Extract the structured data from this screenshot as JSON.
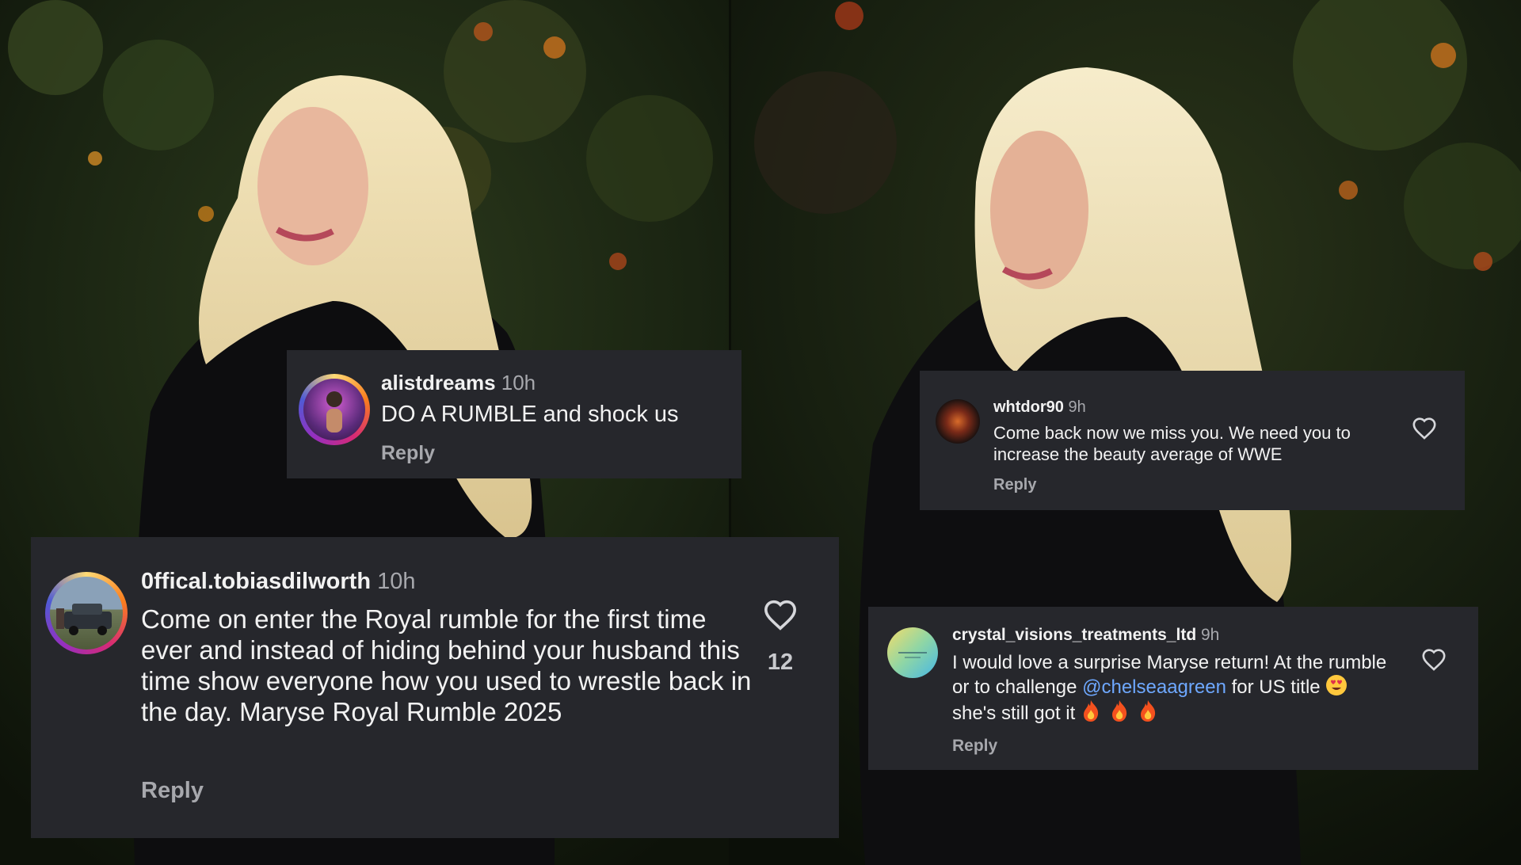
{
  "comments": {
    "c1": {
      "username": "alistdreams",
      "time": "10h",
      "text": "DO A RUMBLE and shock us",
      "reply": "Reply"
    },
    "c2": {
      "username": "0ffical.tobiasdilworth",
      "time": "10h",
      "text": "Come on enter the Royal rumble for the first time ever and instead of hiding behind your husband this time show everyone how you used to wrestle back in the day. Maryse Royal Rumble 2025",
      "reply": "Reply",
      "likes": "12"
    },
    "c3": {
      "username": "whtdor90",
      "time": "9h",
      "text": "Come back now we miss you. We need you to increase the beauty average of WWE",
      "reply": "Reply"
    },
    "c4": {
      "username": "crystal_visions_treatments_ltd",
      "time": "9h",
      "text_before": "I would love a surprise Maryse return! At the rumble or to challenge ",
      "mention": "@chelseaagreen",
      "text_after": " for US title ",
      "text_after_emoji": " she's still got it ",
      "reply": "Reply"
    }
  },
  "icons": {
    "heart": "heart-outline-icon",
    "emoji_love": "heart-eyes-emoji-icon",
    "emoji_fire": "fire-emoji-icon"
  },
  "colors": {
    "card": "#26272c",
    "mention": "#6ea8ff",
    "muted": "#a7a8ad"
  }
}
